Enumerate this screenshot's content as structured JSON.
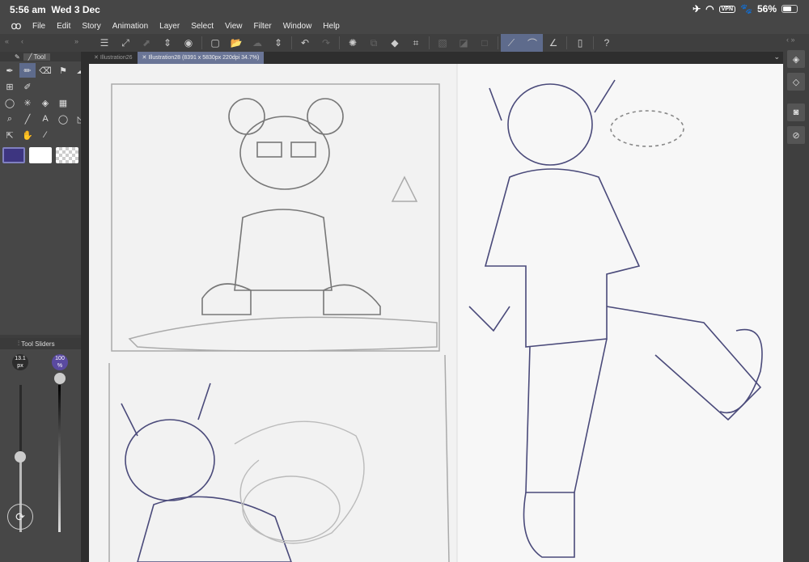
{
  "status_bar": {
    "time": "5:56 am",
    "date": "Wed 3 Dec",
    "vpn": "VPN",
    "battery": "56%",
    "battery_level": 56
  },
  "menu": {
    "items": [
      "File",
      "Edit",
      "Story",
      "Animation",
      "Layer",
      "Select",
      "View",
      "Filter",
      "Window",
      "Help"
    ]
  },
  "tabs": [
    {
      "label": "Illustration26",
      "active": false
    },
    {
      "label": "Illustration28 (8391 x 5830px 220dpi 34.7%)",
      "active": true
    }
  ],
  "tool_panel": {
    "title": "Tool",
    "colors": {
      "main": "#3d3580",
      "sub": "#ffffff"
    }
  },
  "tool_sliders": {
    "title": "Tool Sliders",
    "size_value": "13.1",
    "size_unit": "px",
    "opacity_value": "100",
    "opacity_unit": "%",
    "opacity_percent": 100
  },
  "accent": "#5e6b8c"
}
